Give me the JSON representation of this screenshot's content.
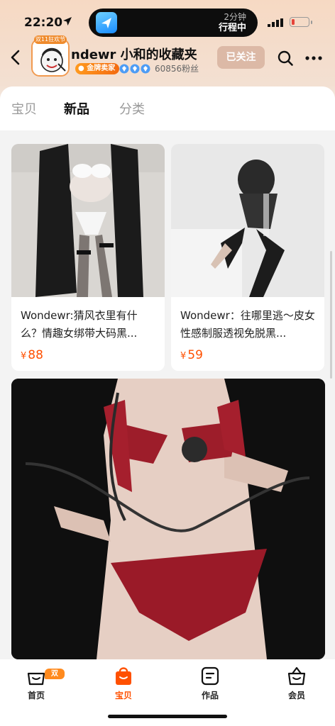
{
  "status_bar": {
    "time": "22:20",
    "eta_time": "2分钟",
    "eta_label": "行程中",
    "battery_level": 0.2
  },
  "header": {
    "avatar_badge": "双11狂欢节",
    "shop_name": "ndewr 小和的收藏夹",
    "shop_badge": "金牌卖家",
    "fans": "60856粉丝",
    "follow_label": "已关注",
    "diamond_count": 3
  },
  "tabs": [
    {
      "label": "宝贝",
      "active": false
    },
    {
      "label": "新品",
      "active": true
    },
    {
      "label": "分类",
      "active": false
    }
  ],
  "products": [
    {
      "title": "Wondewr:猜风衣里有什么？情趣女绑带大码黑...",
      "price_symbol": "¥",
      "price": "88"
    },
    {
      "title": "Wondewr：往哪里逃～皮女性感制服透视免脱黑...",
      "price_symbol": "¥",
      "price": "59"
    }
  ],
  "tabbar": {
    "items": [
      {
        "label": "首页",
        "icon": "home-basket-icon",
        "badge": "双11"
      },
      {
        "label": "宝贝",
        "icon": "shopping-bag-icon",
        "active": true
      },
      {
        "label": "作品",
        "icon": "works-icon"
      },
      {
        "label": "会员",
        "icon": "member-basket-icon"
      }
    ]
  },
  "colors": {
    "accent": "#ff5000",
    "header_bg": "#f6d9c3",
    "follow_bg": "#dcb9a6"
  }
}
